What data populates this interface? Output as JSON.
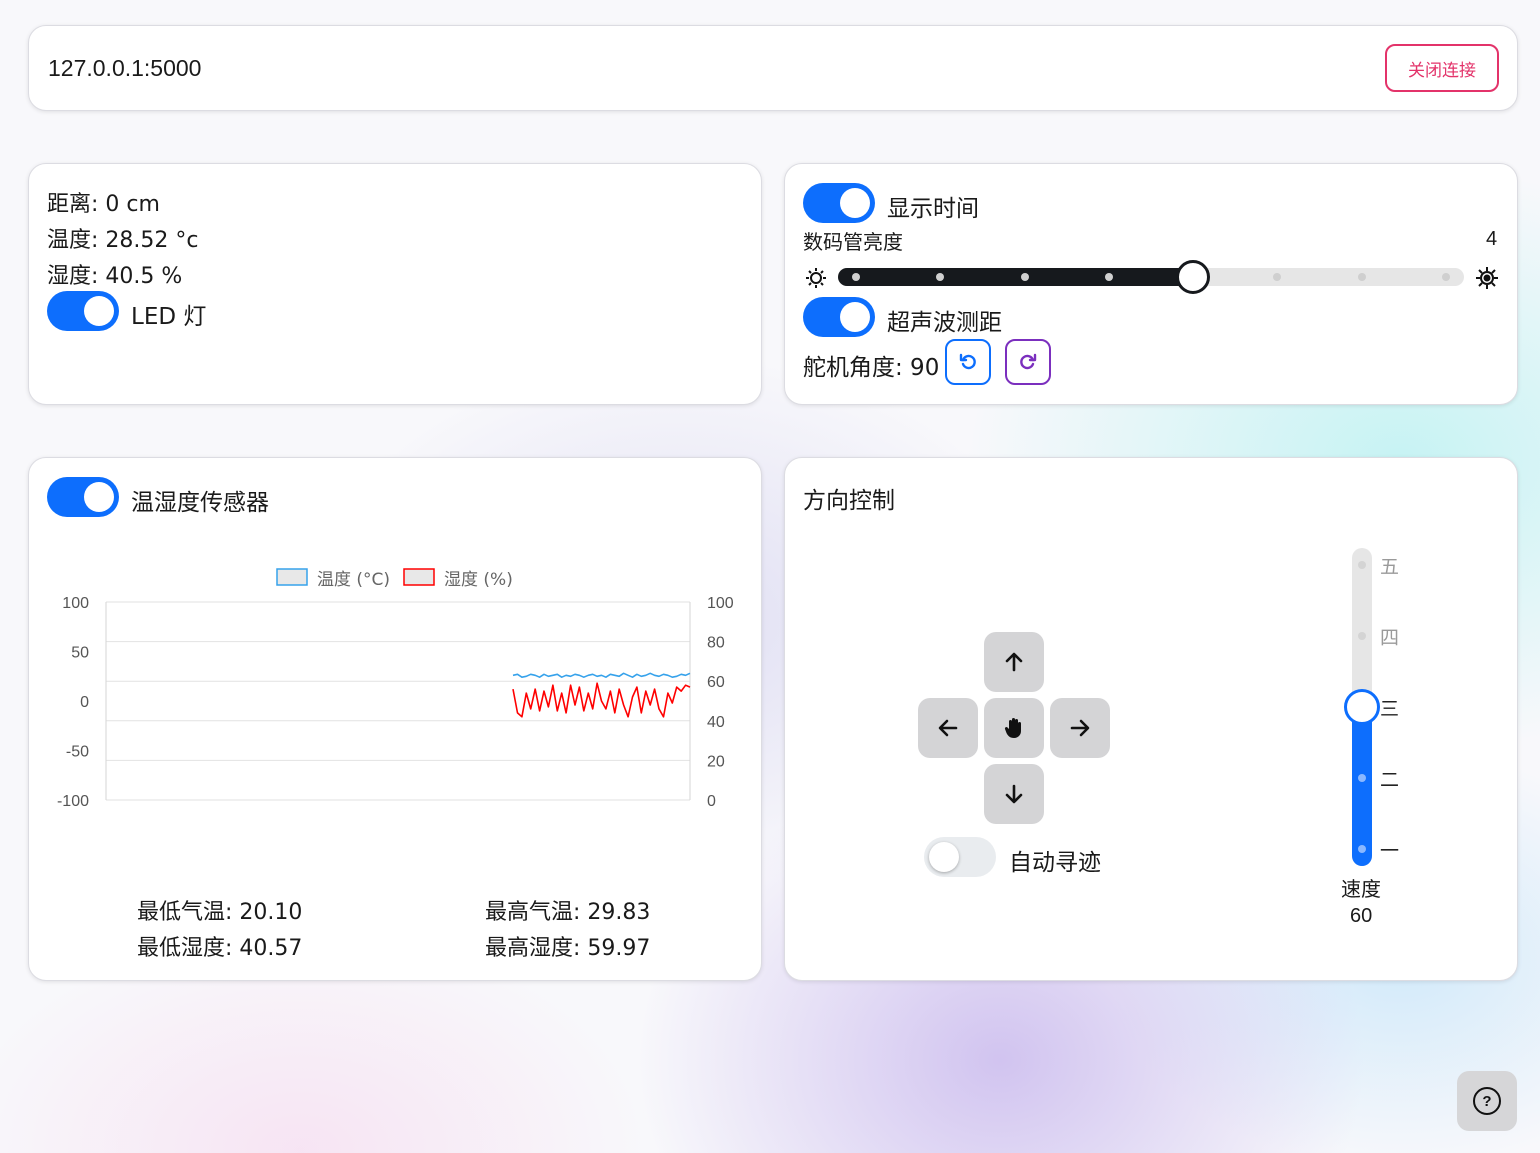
{
  "connection": {
    "url": "127.0.0.1:5000",
    "close_label": "关闭连接",
    "accent": "#e3336a"
  },
  "sensors": {
    "distance": "距离: 0 cm",
    "temperature": "温度: 28.52 °c",
    "humidity": "湿度: 40.5 %",
    "led_label": "LED 灯",
    "led_on": true
  },
  "controls": {
    "show_time_label": "显示时间",
    "show_time_on": true,
    "brightness_label": "数码管亮度",
    "brightness_value": "4",
    "brightness_level": 4,
    "brightness_max": 7,
    "ultrasonic_label": "超声波测距",
    "ultrasonic_on": true,
    "servo_label": "舵机角度: 90",
    "rotate_left_icon": "rotate-ccw-icon",
    "rotate_right_icon": "rotate-cw-icon",
    "dim_icon": "brightness-low-icon",
    "bright_icon": "brightness-high-icon"
  },
  "chart_card": {
    "toggle_label": "温湿度传感器",
    "toggle_on": true,
    "min_temp": "最低气温: 20.10",
    "max_temp": "最高气温: 29.83",
    "min_hum": "最低湿度: 40.57",
    "max_hum": "最高湿度: 59.97"
  },
  "chart_data": {
    "type": "line",
    "title": "",
    "series": [
      {
        "name": "温度 (°C)",
        "axis": "left",
        "color": "#36a2eb",
        "values": [
          26,
          27,
          24,
          25,
          27,
          26,
          24,
          27,
          25,
          26,
          27,
          24,
          26,
          25,
          27,
          26,
          24,
          26,
          27,
          25,
          26,
          24,
          27,
          26,
          25,
          28,
          26,
          24,
          27,
          25,
          26,
          28,
          26,
          25,
          27,
          26,
          24,
          25,
          27,
          26,
          28
        ]
      },
      {
        "name": "湿度 (%)",
        "axis": "right",
        "color": "#ff0000",
        "values": [
          56,
          44,
          42,
          54,
          46,
          56,
          45,
          55,
          47,
          58,
          45,
          54,
          44,
          58,
          48,
          57,
          45,
          54,
          46,
          59,
          50,
          46,
          55,
          44,
          56,
          48,
          42,
          52,
          57,
          44,
          55,
          48,
          56,
          46,
          42,
          54,
          49,
          57,
          55,
          58,
          57
        ]
      }
    ],
    "x_start_fraction": 0.697,
    "y_left": {
      "ticks": [
        100,
        50,
        0,
        -50,
        -100
      ],
      "ylim": [
        -100,
        100
      ]
    },
    "y_right": {
      "ticks": [
        100,
        80,
        60,
        40,
        20,
        0
      ],
      "ylim": [
        0,
        100
      ]
    },
    "grid": true,
    "legend_position": "top"
  },
  "direction": {
    "title": "方向控制",
    "up_icon": "arrow-up-icon",
    "down_icon": "arrow-down-icon",
    "left_icon": "arrow-left-icon",
    "right_icon": "arrow-right-icon",
    "stop_icon": "hand-stop-icon",
    "auto_track_label": "自动寻迹",
    "auto_track_on": false,
    "speed_label": "速度",
    "speed_value": "60",
    "speed_levels": [
      "五",
      "四",
      "三",
      "二",
      "一"
    ],
    "speed_level_index": 2,
    "accent": "#0d6efd"
  },
  "help": {
    "icon": "help-icon"
  }
}
